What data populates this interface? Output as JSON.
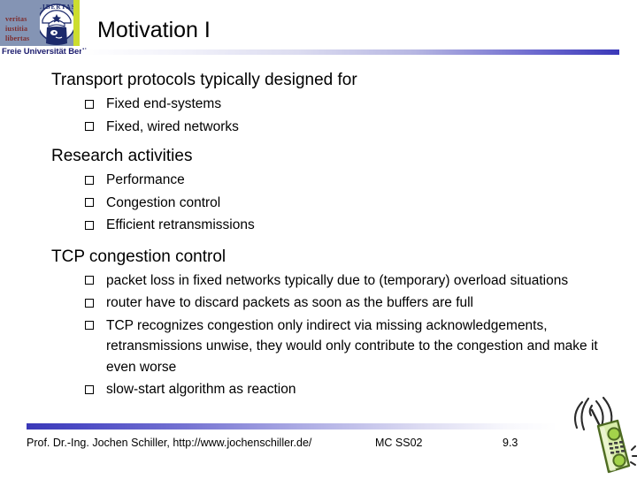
{
  "header": {
    "title": "Motivation I",
    "logo": {
      "motto_lines": [
        "veritas",
        "iustitia",
        "libertas"
      ],
      "seal_text": "LIBERTAS",
      "university": "Freie Universität Berlin",
      "colors": {
        "logo_background": "#8494b4",
        "motto_text": "#7e2b2b",
        "accent_bar": "#ccdd2e",
        "university_text": "#1c1c6e"
      }
    },
    "rule_gradient": [
      "#ffffff",
      "#3a38b8"
    ]
  },
  "content": {
    "groups": [
      {
        "heading": "Transport protocols typically designed for",
        "bullets": [
          "Fixed end-systems",
          "Fixed, wired networks"
        ]
      },
      {
        "heading": "Research activities",
        "bullets": [
          "Performance",
          "Congestion control",
          "Efficient retransmissions"
        ]
      },
      {
        "heading": "TCP congestion control",
        "bullets": [
          "packet loss in fixed networks typically due to (temporary) overload situations",
          "router have to discard packets as soon as the buffers are full",
          "TCP recognizes congestion only indirect via missing acknowledgements, retransmissions unwise, they would only contribute to the congestion and make it even worse",
          "slow-start algorithm as reaction"
        ]
      }
    ],
    "bullet_marker": "hollow-square"
  },
  "footer": {
    "author": "Prof. Dr.-Ing. Jochen Schiller, http://www.jochenschiller.de/",
    "course": "MC SS02",
    "page": "9.3",
    "rule_gradient": [
      "#3a38b8",
      "#ffffff"
    ]
  },
  "decoration": {
    "phone": {
      "name": "mobile-phone-clipart",
      "body_color": "#d4e9a0",
      "outline_color": "#5f7a2a",
      "button_color": "#9ecc3b"
    }
  }
}
